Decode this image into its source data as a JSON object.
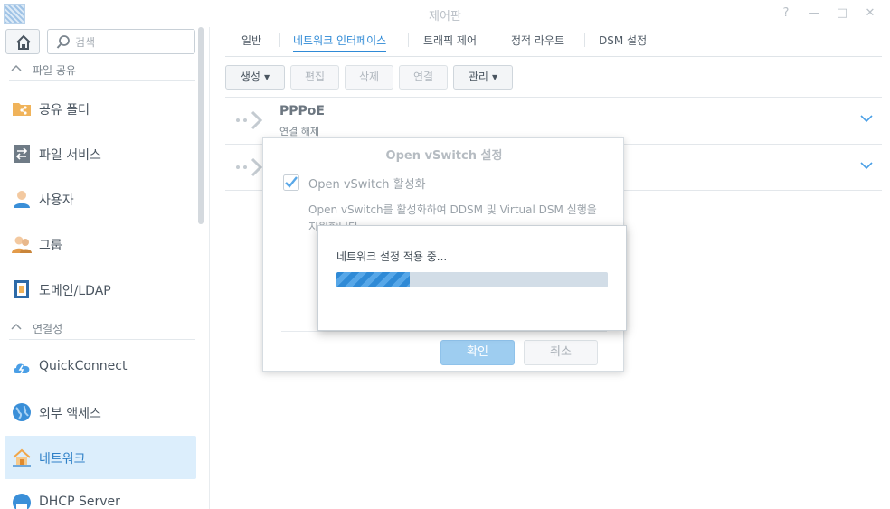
{
  "window": {
    "title": "제어판",
    "help": "?",
    "minimize": "—",
    "maximize": "□",
    "close": "✕"
  },
  "sidebar": {
    "search_placeholder": "검색",
    "sections": [
      {
        "label": "파일 공유",
        "items": [
          {
            "label": "공유 폴더",
            "icon": "shared-folder-icon"
          },
          {
            "label": "파일 서비스",
            "icon": "file-services-icon"
          },
          {
            "label": "사용자",
            "icon": "user-icon"
          },
          {
            "label": "그룹",
            "icon": "group-icon"
          },
          {
            "label": "도메인/LDAP",
            "icon": "domain-ldap-icon"
          }
        ]
      },
      {
        "label": "연결성",
        "items": [
          {
            "label": "QuickConnect",
            "icon": "quickconnect-icon"
          },
          {
            "label": "외부 액세스",
            "icon": "external-access-icon"
          },
          {
            "label": "네트워크",
            "icon": "network-icon",
            "active": true
          },
          {
            "label": "DHCP Server",
            "icon": "dhcp-server-icon"
          }
        ]
      }
    ]
  },
  "tabs": [
    {
      "label": "일반"
    },
    {
      "label": "네트워크 인터페이스",
      "active": true
    },
    {
      "label": "트래픽 제어"
    },
    {
      "label": "정적 라우트"
    },
    {
      "label": "DSM 설정"
    }
  ],
  "toolbar": {
    "create": "생성",
    "edit": "편집",
    "delete": "삭제",
    "connect": "연결",
    "manage": "관리"
  },
  "interfaces": [
    {
      "name": "PPPoE",
      "status": "연결 해제"
    },
    {
      "name": "",
      "status": ""
    }
  ],
  "dialog": {
    "title": "Open vSwitch 설정",
    "checkbox_label": "Open vSwitch 활성화",
    "checkbox_checked": true,
    "description": "Open vSwitch를 활성화하여 DDSM 및 Virtual DSM 실행을 지원합니다.",
    "ok": "확인",
    "cancel": "취소"
  },
  "progress": {
    "text": "네트워크 설정 적용 중...",
    "percent": 27
  },
  "colors": {
    "accent": "#2f8ad6",
    "active_bg": "#dceefc"
  }
}
